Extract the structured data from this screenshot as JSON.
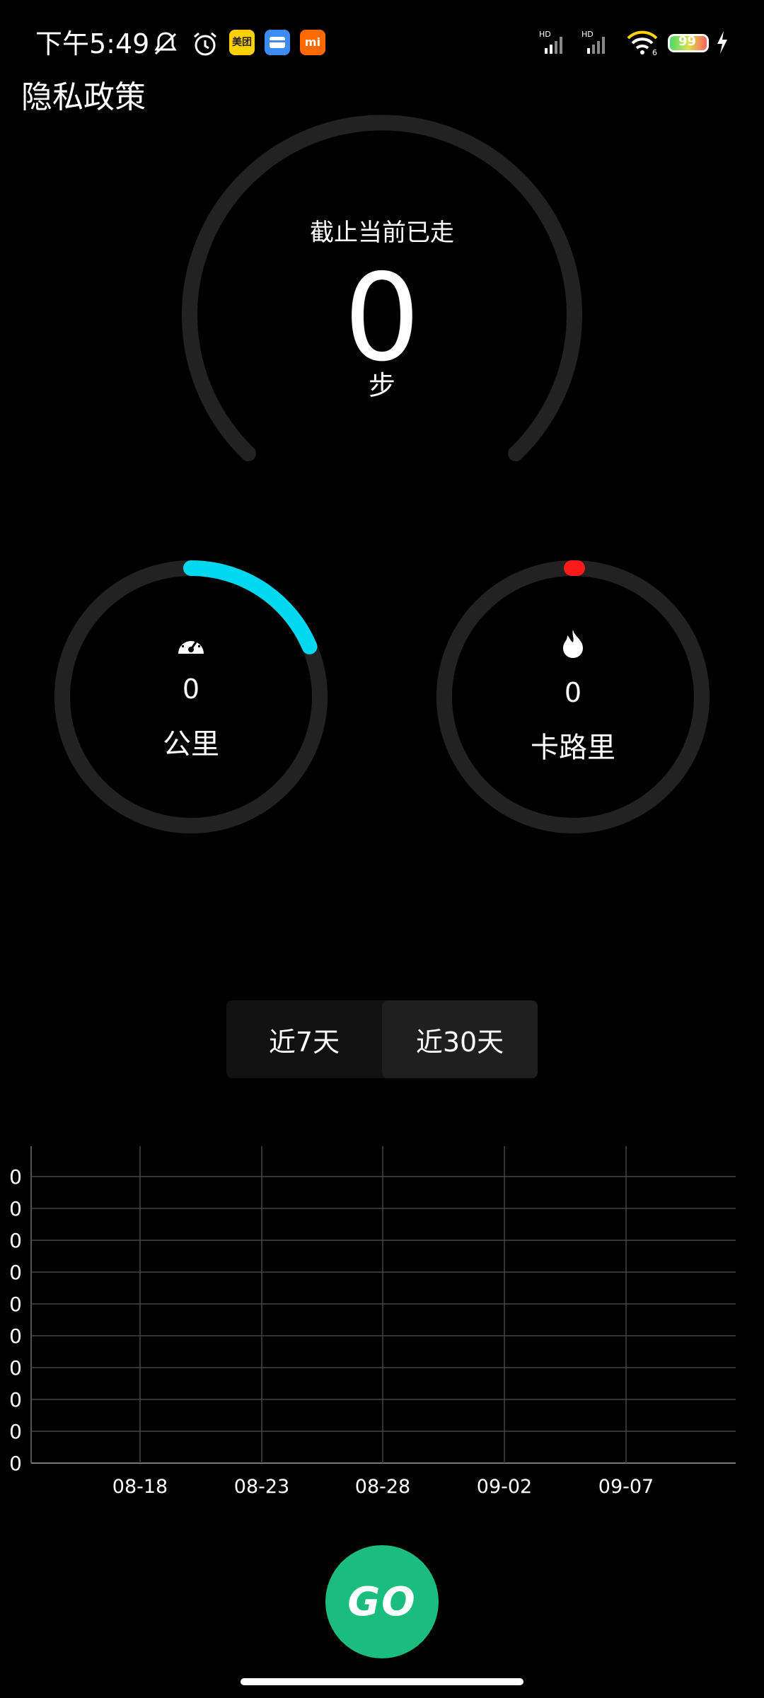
{
  "status_bar": {
    "time": "下午5:49",
    "app_icons": [
      "美团",
      "wallet-icon",
      "mi"
    ],
    "battery": "99"
  },
  "header": {
    "privacy_link": "隐私政策"
  },
  "steps": {
    "caption": "截止当前已走",
    "value": "0",
    "unit": "步"
  },
  "distance": {
    "value": "0",
    "unit": "公里",
    "icon": "speedometer-icon",
    "color": "#00d8f0"
  },
  "calories": {
    "value": "0",
    "unit": "卡路里",
    "icon": "flame-icon",
    "color": "#ff1a1a"
  },
  "range_tabs": [
    {
      "label": "近7天",
      "active": false
    },
    {
      "label": "近30天",
      "active": true
    }
  ],
  "chart_data": {
    "type": "line",
    "x_tick_labels": [
      "08-18",
      "08-23",
      "08-28",
      "09-02",
      "09-07"
    ],
    "y_tick_labels": [
      "0",
      "0",
      "0",
      "0",
      "0",
      "0",
      "0",
      "0",
      "0",
      "0"
    ],
    "series": [
      {
        "color": "#33ff00",
        "values": []
      }
    ],
    "grid": true
  },
  "go_button": {
    "label": "GO",
    "color": "#1bbd7e"
  }
}
